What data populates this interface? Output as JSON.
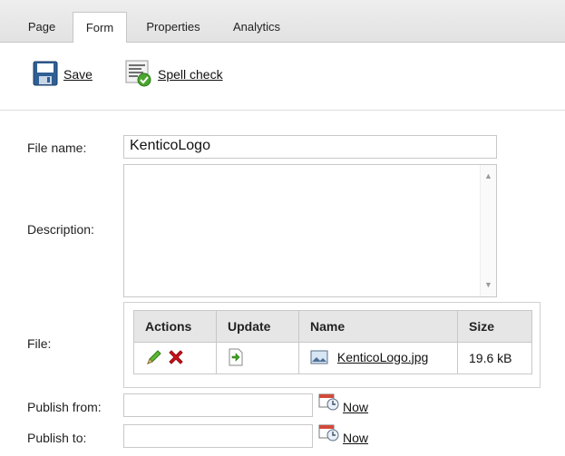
{
  "tabs": [
    {
      "label": "Page",
      "active": false
    },
    {
      "label": "Form",
      "active": true
    },
    {
      "label": "Properties",
      "active": false
    },
    {
      "label": "Analytics",
      "active": false
    }
  ],
  "toolbar": {
    "save_label": "Save",
    "spell_label": "Spell check"
  },
  "form": {
    "file_name_label": "File name:",
    "file_name_value": "KenticoLogo",
    "description_label": "Description:",
    "description_value": "",
    "file_label": "File:",
    "publish_from_label": "Publish from:",
    "publish_from_value": "",
    "publish_to_label": "Publish to:",
    "publish_to_value": "",
    "now_label": "Now"
  },
  "file_table": {
    "headers": [
      "Actions",
      "Update",
      "Name",
      "Size"
    ],
    "rows": [
      {
        "name": "KenticoLogo.jpg",
        "size": "19.6 kB"
      }
    ]
  },
  "colors": {
    "delete_red": "#d0101a",
    "edit_green": "#3a8f1e",
    "tab_bg": "#e6e6e6",
    "header_bg": "#e6e6e6"
  },
  "icons": {
    "save": "floppy-disk-icon",
    "spell": "spell-check-icon",
    "edit": "pencil-icon",
    "delete": "delete-x-icon",
    "update": "upload-file-icon",
    "file": "image-file-icon",
    "calendar": "calendar-icon"
  }
}
